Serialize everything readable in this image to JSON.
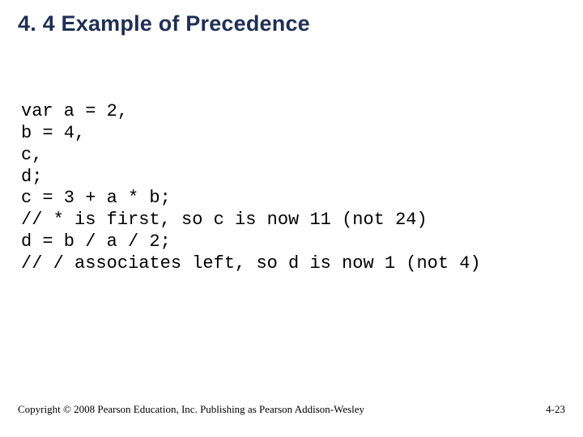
{
  "title": "4. 4 Example of Precedence",
  "code_lines": [
    "var a = 2,",
    "b = 4,",
    "c,",
    "d;",
    "c = 3 + a * b;",
    "// * is first, so c is now 11 (not 24)",
    "d = b / a / 2;",
    "// / associates left, so d is now 1 (not 4)"
  ],
  "footer": {
    "copyright": "Copyright © 2008 Pearson Education, Inc. Publishing as Pearson Addison-Wesley",
    "page": "4-23"
  }
}
